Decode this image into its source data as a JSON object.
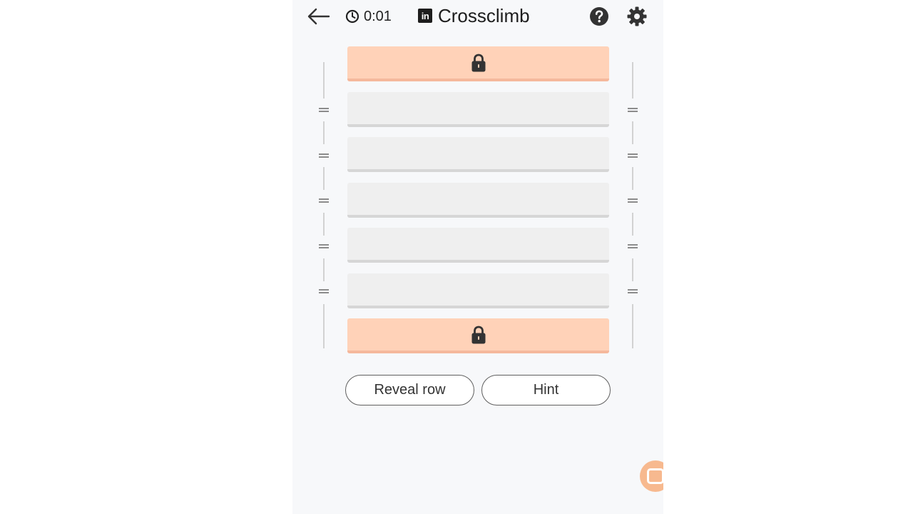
{
  "header": {
    "back_icon": "arrow-left-icon",
    "timer_icon": "clock-icon",
    "timer": "0:01",
    "logo_text": "in",
    "title": "Crossclimb",
    "help_icon": "question-icon",
    "settings_icon": "gear-icon"
  },
  "board": {
    "rows": [
      {
        "state": "locked",
        "icon": "lock-icon"
      },
      {
        "state": "empty"
      },
      {
        "state": "empty"
      },
      {
        "state": "empty"
      },
      {
        "state": "empty"
      },
      {
        "state": "empty"
      },
      {
        "state": "locked",
        "icon": "lock-icon"
      }
    ],
    "colors": {
      "locked_row": "#ffd2b8",
      "empty_row": "#efefef"
    }
  },
  "actions": {
    "reveal_label": "Reveal row",
    "hint_label": "Hint"
  },
  "fab": {
    "icon": "chat-icon",
    "color": "#f7b98f"
  }
}
